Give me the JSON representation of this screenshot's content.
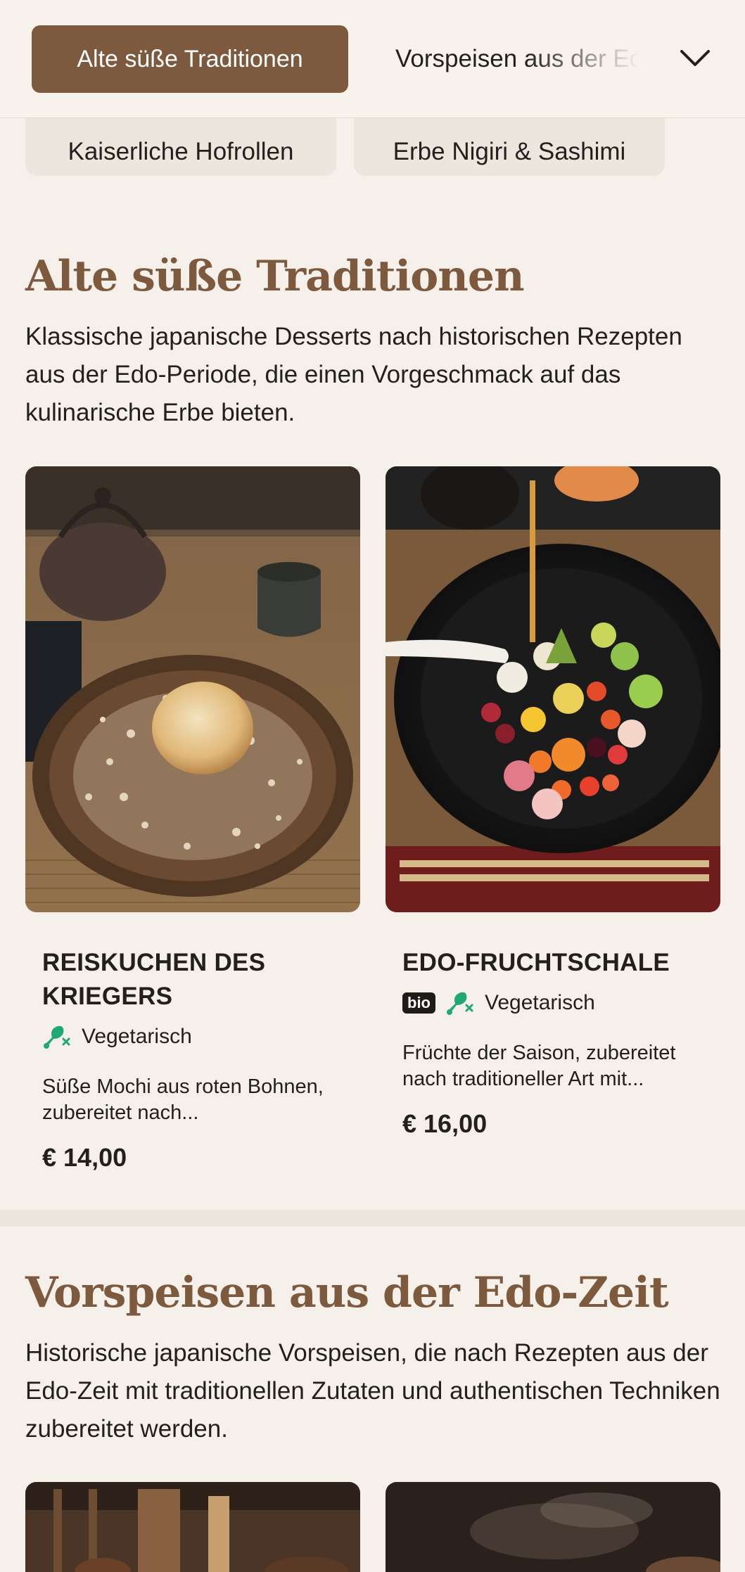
{
  "nav": {
    "active_category": "Alte süße Traditionen",
    "next_category": "Vorspeisen aus der Edo-Zeit",
    "pills": [
      "Kaiserliche Hofrollen",
      "Erbe Nigiri & Sashimi"
    ]
  },
  "sections": [
    {
      "title": "Alte süße Traditionen",
      "description": "Klassische japanische Desserts nach historischen Rezepten aus der Edo-Periode, die einen Vorgeschmack auf das kulinarische Erbe bieten.",
      "items": [
        {
          "name": "Reiskuchen des Kriegers",
          "bio": false,
          "diet": "Vegetarisch",
          "description": "Süße Mochi aus roten Bohnen, zubereitet nach...",
          "price": "€ 14,00"
        },
        {
          "name": "Edo-Fruchtschale",
          "bio": true,
          "bio_label": "bio",
          "diet": "Vegetarisch",
          "description": "Früchte der Saison, zubereitet nach traditioneller Art mit...",
          "price": "€ 16,00"
        }
      ]
    },
    {
      "title": "Vorspeisen aus der Edo-Zeit",
      "description": "Historische japanische Vorspeisen, die nach Rezepten aus der Edo-Zeit mit traditionellen Zutaten und authentischen Techniken zubereitet werden."
    }
  ],
  "icons": {
    "expand": "chevron-down-icon",
    "vegetarian": "no-meat-icon"
  },
  "colors": {
    "brand": "#7d5a3e",
    "background": "#f5f1ea",
    "vegetarian": "#1fa971"
  }
}
